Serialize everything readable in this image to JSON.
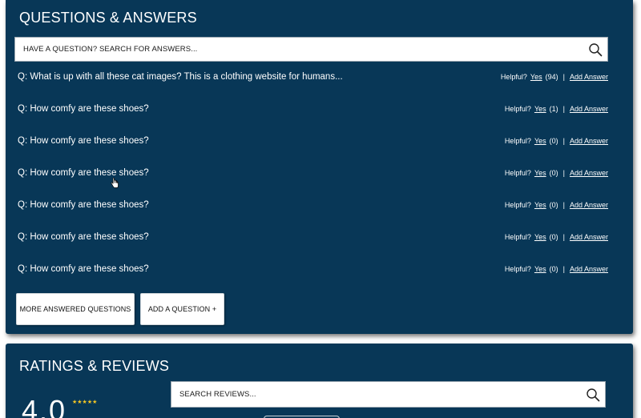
{
  "qa": {
    "title": "QUESTIONS & ANSWERS",
    "search_placeholder": "HAVE A QUESTION? SEARCH FOR ANSWERS...",
    "helpful_label": "Helpful?",
    "yes_label": "Yes",
    "add_answer_label": "Add Answer",
    "separator": "|",
    "questions": [
      {
        "text": "Q: What is up with all these cat images? This is a clothing website for humans...",
        "count": "(94)"
      },
      {
        "text": "Q: How comfy are these shoes?",
        "count": "(1)"
      },
      {
        "text": "Q: How comfy are these shoes?",
        "count": "(0)"
      },
      {
        "text": "Q: How comfy are these shoes?",
        "count": "(0)"
      },
      {
        "text": "Q: How comfy are these shoes?",
        "count": "(0)"
      },
      {
        "text": "Q: How comfy are these shoes?",
        "count": "(0)"
      },
      {
        "text": "Q: How comfy are these shoes?",
        "count": "(0)"
      }
    ],
    "more_button": "MORE ANSWERED QUESTIONS",
    "add_question_button": "ADD A QUESTION +"
  },
  "reviews": {
    "title": "RATINGS & REVIEWS",
    "search_placeholder": "SEARCH REVIEWS...",
    "rating": "4.0",
    "stars": "★★★★★",
    "star_rating": 4
  },
  "colors": {
    "panel": "#083757",
    "star": "#f3c623"
  },
  "icons": {
    "search": "search-icon",
    "cursor": "hand-cursor-icon"
  }
}
